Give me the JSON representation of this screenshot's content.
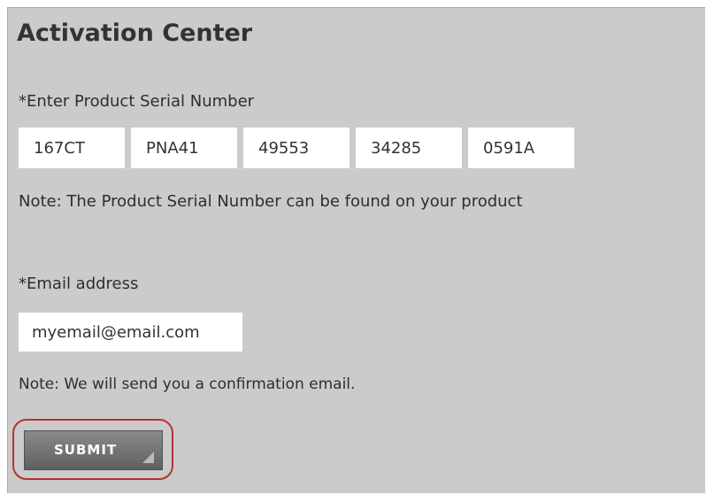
{
  "page": {
    "title": "Activation Center"
  },
  "serial": {
    "label": "*Enter Product Serial Number",
    "parts": [
      "167CT",
      "PNA41",
      "49553",
      "34285",
      "0591A"
    ],
    "note": "Note: The Product Serial Number can be found on your product"
  },
  "email": {
    "label": "*Email address",
    "value": "myemail@email.com",
    "note": "Note: We will send you a confirmation email."
  },
  "submit": {
    "label": "SUBMIT",
    "highlight_color": "#b3332c"
  },
  "colors": {
    "panel_background": "#cbcbcb",
    "input_background": "#ffffff",
    "button_background": "#6e6e6e"
  }
}
